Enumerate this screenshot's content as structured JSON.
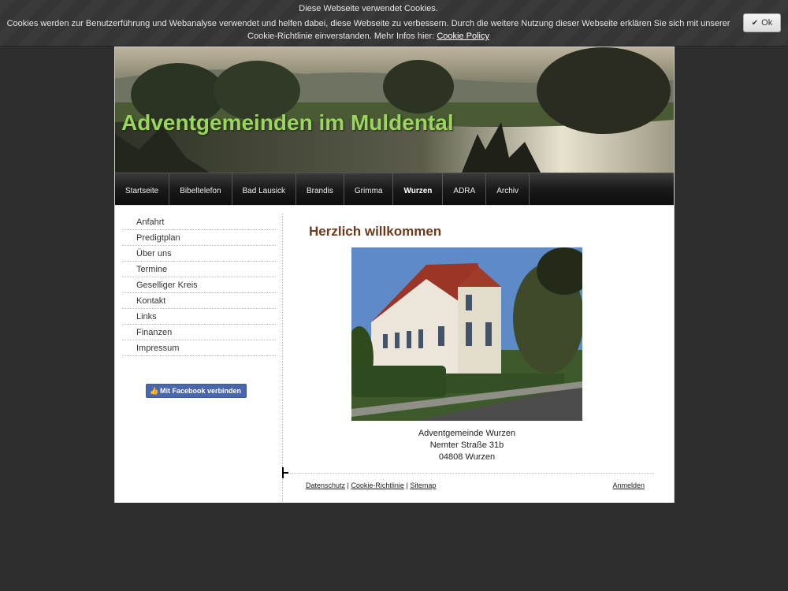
{
  "cookie": {
    "title": "Diese Webseite verwendet Cookies.",
    "text": "Cookies werden zur Benutzerführung und Webanalyse verwendet und helfen dabei, diese Webseite zu verbessern. Durch die weitere Nutzung dieser Webseite erklären Sie sich mit unserer Cookie-Richtlinie einverstanden. Mehr Infos hier: ",
    "link": "Cookie Policy",
    "ok_label": "Ok"
  },
  "site": {
    "title": "Adventgemeinden im Muldental"
  },
  "nav": {
    "items": [
      "Startseite",
      "Bibeltelefon",
      "Bad Lausick",
      "Brandis",
      "Grimma",
      "Wurzen",
      "ADRA",
      "Archiv"
    ],
    "active": "Wurzen"
  },
  "sidebar": {
    "items": [
      "Anfahrt",
      "Predigtplan",
      "Über uns",
      "Termine",
      "Geselliger Kreis",
      "Kontakt",
      "Links",
      "Finanzen",
      "Impressum"
    ],
    "facebook_label": "Mit Facebook verbinden"
  },
  "main": {
    "title": "Herzlich willkommen",
    "address": [
      "Adventgemeinde Wurzen",
      "Nemter Straße 31b",
      "04808 Wurzen"
    ]
  },
  "footer": {
    "privacy": "Datenschutz",
    "cookie_policy": "Cookie-Richtlinie",
    "sitemap": "Sitemap",
    "separator": "|",
    "login": "Anmelden"
  },
  "colors": {
    "site_title": "#9bd55f",
    "main_title": "#6b3a1a",
    "facebook": "#4a66ad"
  }
}
